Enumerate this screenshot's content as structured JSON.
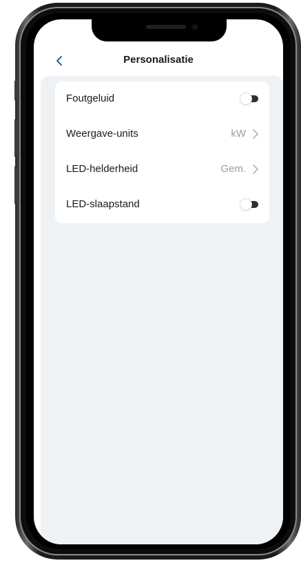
{
  "header": {
    "title": "Personalisatie",
    "back_icon": "chevron-left-icon"
  },
  "colors": {
    "accent": "#1f5fa8",
    "background": "#eff2f5",
    "card": "#ffffff",
    "toggle_track": "#2d2f33",
    "value_text": "#9a9ca0"
  },
  "settings": {
    "items": [
      {
        "label": "Foutgeluid",
        "type": "toggle",
        "checked": false
      },
      {
        "label": "Weergave-units",
        "type": "select",
        "value": "kW"
      },
      {
        "label": "LED-helderheid",
        "type": "select",
        "value": "Gem."
      },
      {
        "label": "LED-slaapstand",
        "type": "toggle",
        "checked": false
      }
    ]
  }
}
